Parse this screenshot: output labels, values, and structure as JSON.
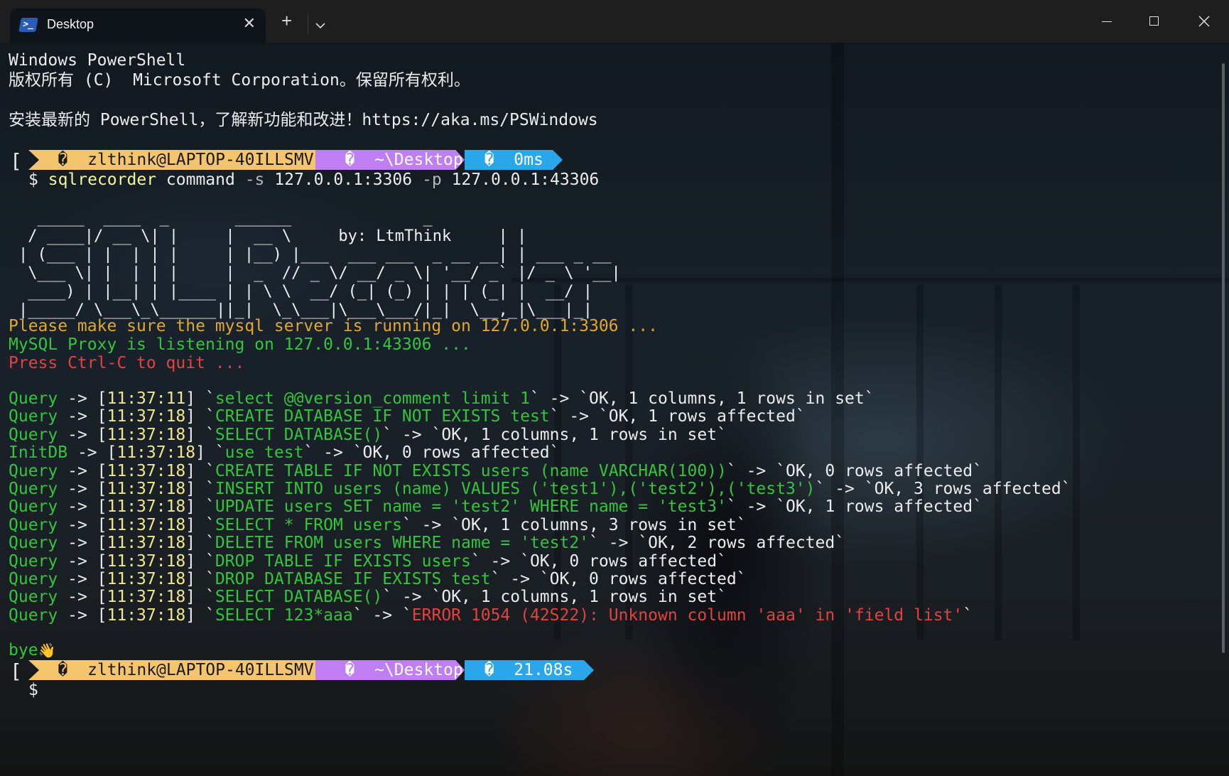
{
  "window": {
    "tab_title": "Desktop",
    "close_tab_glyph": "✕",
    "new_tab_glyph": "+",
    "icons": [
      "powershell-icon",
      "close-icon",
      "plus-icon",
      "chevron-down-icon",
      "minimize-icon",
      "maximize-icon",
      "close-window-icon"
    ]
  },
  "header": {
    "line1": "Windows PowerShell",
    "line2": "版权所有 (C)  Microsoft Corporation。保留所有权利。",
    "line3": "安装最新的 PowerShell，了解新功能和改进！https://aka.ms/PSWindows"
  },
  "prompt1": {
    "bracket": "[",
    "user": "zlthink@LAPTOP-40ILLSMV",
    "path": "~\\Desktop",
    "time": "0ms",
    "glyph": "�",
    "dollar": "$",
    "command": "sqlrecorder",
    "subcommand": "command",
    "flag_s": "-s",
    "arg_s": "127.0.0.1:3306",
    "flag_p": "-p",
    "arg_p": "127.0.0.1:43306"
  },
  "banner": {
    "lines": [
      "  _____  ____  _       ______              _          ",
      " / ____|/ __ \\| |     |  __ \\     by: LtmThink     | |",
      "| (___ | |  | | |     | |__) |___  ___ ___  _ __ __| | ___ _ __",
      " \\___ \\| |  | | |     |  _  // _ \\/ __/ _ \\| '__/ _` |/ _ \\ '__|",
      " ____) | |__| | |____ | | \\ \\  __/ (_| (_) | | | (_| |  __/ |",
      "|_____/ \\___\\_\\______||_|  \\_\\___|\\___\\___/|_|  \\__,_|\\___|_|"
    ]
  },
  "messages": {
    "server": "Please make sure the mysql server is running on 127.0.0.1:3306 ...",
    "proxy": "MySQL Proxy is listening on 127.0.0.1:43306 ...",
    "quit": "Press Ctrl-C to quit ..."
  },
  "log": [
    {
      "type": "Query",
      "time": "11:37:11",
      "sql": "select @@version_comment limit 1",
      "result": "OK, 1 columns, 1 rows in set",
      "error": false
    },
    {
      "type": "Query",
      "time": "11:37:18",
      "sql": "CREATE DATABASE IF NOT EXISTS test",
      "result": "OK, 1 rows affected",
      "error": false
    },
    {
      "type": "Query",
      "time": "11:37:18",
      "sql": "SELECT DATABASE()",
      "result": "OK, 1 columns, 1 rows in set",
      "error": false
    },
    {
      "type": "InitDB",
      "time": "11:37:18",
      "sql": "use test",
      "result": "OK, 0 rows affected",
      "error": false
    },
    {
      "type": "Query",
      "time": "11:37:18",
      "sql": "CREATE TABLE IF NOT EXISTS users (name VARCHAR(100))",
      "result": "OK, 0 rows affected",
      "error": false
    },
    {
      "type": "Query",
      "time": "11:37:18",
      "sql": "INSERT INTO users (name) VALUES ('test1'),('test2'),('test3')",
      "result": "OK, 3 rows affected",
      "error": false
    },
    {
      "type": "Query",
      "time": "11:37:18",
      "sql": "UPDATE users SET name = 'test2' WHERE name = 'test3'",
      "result": "OK, 1 rows affected",
      "error": false
    },
    {
      "type": "Query",
      "time": "11:37:18",
      "sql": "SELECT * FROM users",
      "result": "OK, 1 columns, 3 rows in set",
      "error": false
    },
    {
      "type": "Query",
      "time": "11:37:18",
      "sql": "DELETE FROM users WHERE name = 'test2'",
      "result": "OK, 2 rows affected",
      "error": false
    },
    {
      "type": "Query",
      "time": "11:37:18",
      "sql": "DROP TABLE IF EXISTS users",
      "result": "OK, 0 rows affected",
      "error": false
    },
    {
      "type": "Query",
      "time": "11:37:18",
      "sql": "DROP DATABASE IF EXISTS test",
      "result": "OK, 0 rows affected",
      "error": false
    },
    {
      "type": "Query",
      "time": "11:37:18",
      "sql": "SELECT DATABASE()",
      "result": "OK, 1 columns, 1 rows in set",
      "error": false
    },
    {
      "type": "Query",
      "time": "11:37:18",
      "sql": "SELECT 123*aaa",
      "result": "ERROR 1054 (42S22): Unknown column 'aaa' in 'field list'",
      "error": true
    }
  ],
  "bye": {
    "text": "bye",
    "emoji": "👋"
  },
  "prompt2": {
    "bracket": "[",
    "user": "zlthink@LAPTOP-40ILLSMV",
    "path": "~\\Desktop",
    "time": "21.08s",
    "glyph": "�",
    "dollar": "$"
  },
  "colors": {
    "prompt_user_bg": "#f5c56e",
    "prompt_path_bg": "#bf7ef2",
    "prompt_time_bg": "#29a7ea",
    "warning": "#e0a82e",
    "success": "#34c43d",
    "error": "#e2433f"
  }
}
